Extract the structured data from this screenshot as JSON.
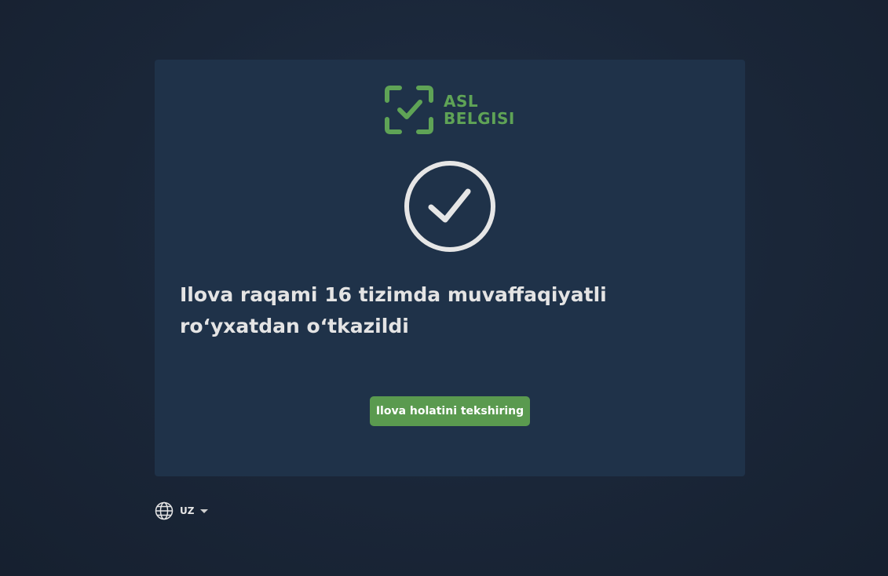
{
  "brand": {
    "name_line1": "ASL",
    "name_line2": "BELGISI",
    "color": "#5fa356"
  },
  "status": {
    "icon": "check-circle-icon",
    "message": "Ilova raqami 16 tizimda muvaffaqiyatli ro‘yxatdan o‘tkazildi"
  },
  "actions": {
    "check_status_label": "Ilova holatini tekshiring",
    "button_color": "#5a9a4f"
  },
  "language": {
    "icon": "globe-icon",
    "selected": "UZ"
  },
  "colors": {
    "background": "#1a2638",
    "card": "#1f3249",
    "text": "#e4e4e4"
  }
}
